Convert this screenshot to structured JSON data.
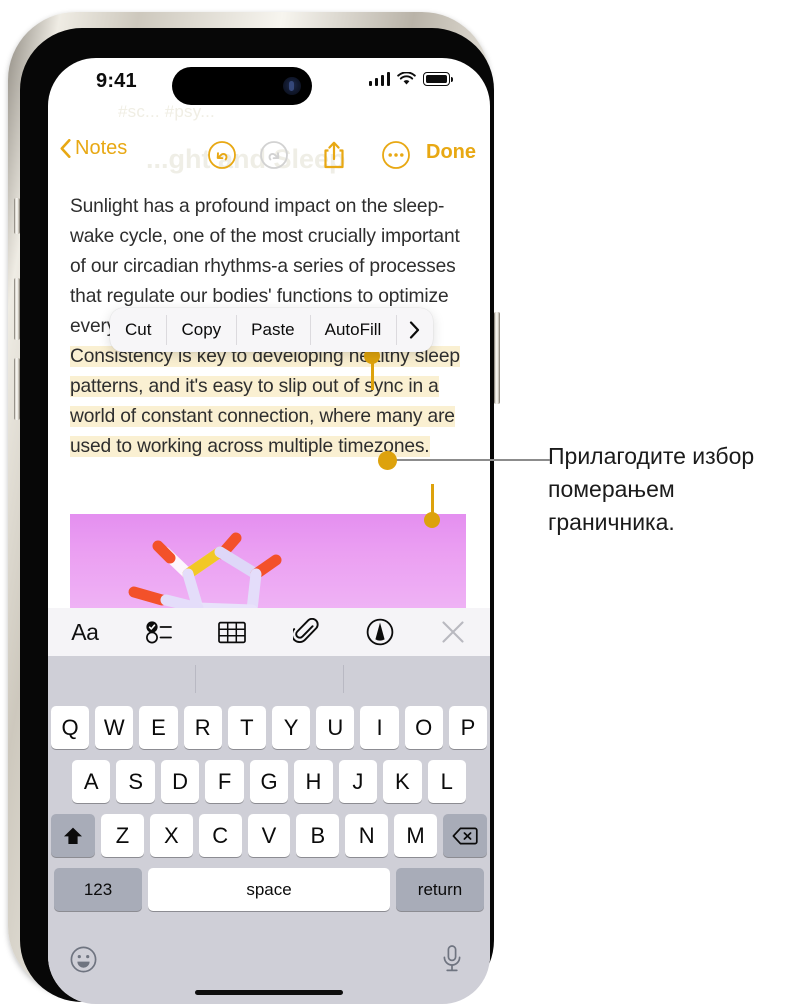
{
  "status_bar": {
    "time": "9:41",
    "icons": [
      "cellular-signal-icon",
      "wifi-icon",
      "battery-icon"
    ]
  },
  "ghost_content": {
    "tags": "#sc... #psy...",
    "title": "...ght and Sleep"
  },
  "nav_bar": {
    "back_label": "Notes",
    "undo_label": "undo-icon",
    "redo_label": "redo-icon",
    "share_label": "share-icon",
    "more_label": "more-icon",
    "done_label": "Done",
    "accent_color": "#e8a813"
  },
  "note": {
    "paragraph_before": "Sunlight has a profound impact on the sleep-wake cycle, one of the most crucially important of our circadian rhythms-a series of processes that regulate our bodies' functions to optimize everything from wakefulness to digestion. ",
    "selected_text": "Consistency is key to developing healthy sleep patterns, and it's easy to slip out of sync in a world of constant connection, where many are used to working across multiple timezones.",
    "highlight_color": "#faf0d2",
    "attachment_name": "molecule-image",
    "attachment_bg": "#eb9ff2"
  },
  "context_menu": {
    "items": [
      "Cut",
      "Copy",
      "Paste",
      "AutoFill"
    ],
    "more_arrow": "›"
  },
  "selection_handles": {
    "start_name": "selection-start-handle",
    "end_name": "selection-end-handle",
    "color": "#dda20c"
  },
  "notes_toolbar": {
    "items": [
      {
        "name": "format-aa-icon",
        "glyph": "Aa"
      },
      {
        "name": "checklist-icon",
        "glyph": ""
      },
      {
        "name": "table-icon",
        "glyph": ""
      },
      {
        "name": "attachment-paperclip-icon",
        "glyph": ""
      },
      {
        "name": "markup-pen-icon",
        "glyph": ""
      },
      {
        "name": "close-icon",
        "glyph": ""
      }
    ]
  },
  "keyboard": {
    "predictions": [
      "",
      "",
      ""
    ],
    "row1": [
      "Q",
      "W",
      "E",
      "R",
      "T",
      "Y",
      "U",
      "I",
      "O",
      "P"
    ],
    "row2": [
      "A",
      "S",
      "D",
      "F",
      "G",
      "H",
      "J",
      "K",
      "L"
    ],
    "row3_letters": [
      "Z",
      "X",
      "C",
      "V",
      "B",
      "N",
      "M"
    ],
    "shift_label": "shift-icon",
    "delete_label": "delete-icon",
    "numbers_label": "123",
    "space_label": "space",
    "return_label": "return",
    "emoji_label": "emoji-icon",
    "dictation_label": "microphone-icon"
  },
  "callout": {
    "text": "Прилагодите избор померањем граничника.",
    "dot_color": "#dda20c",
    "line_color": "#8c8c8c"
  }
}
